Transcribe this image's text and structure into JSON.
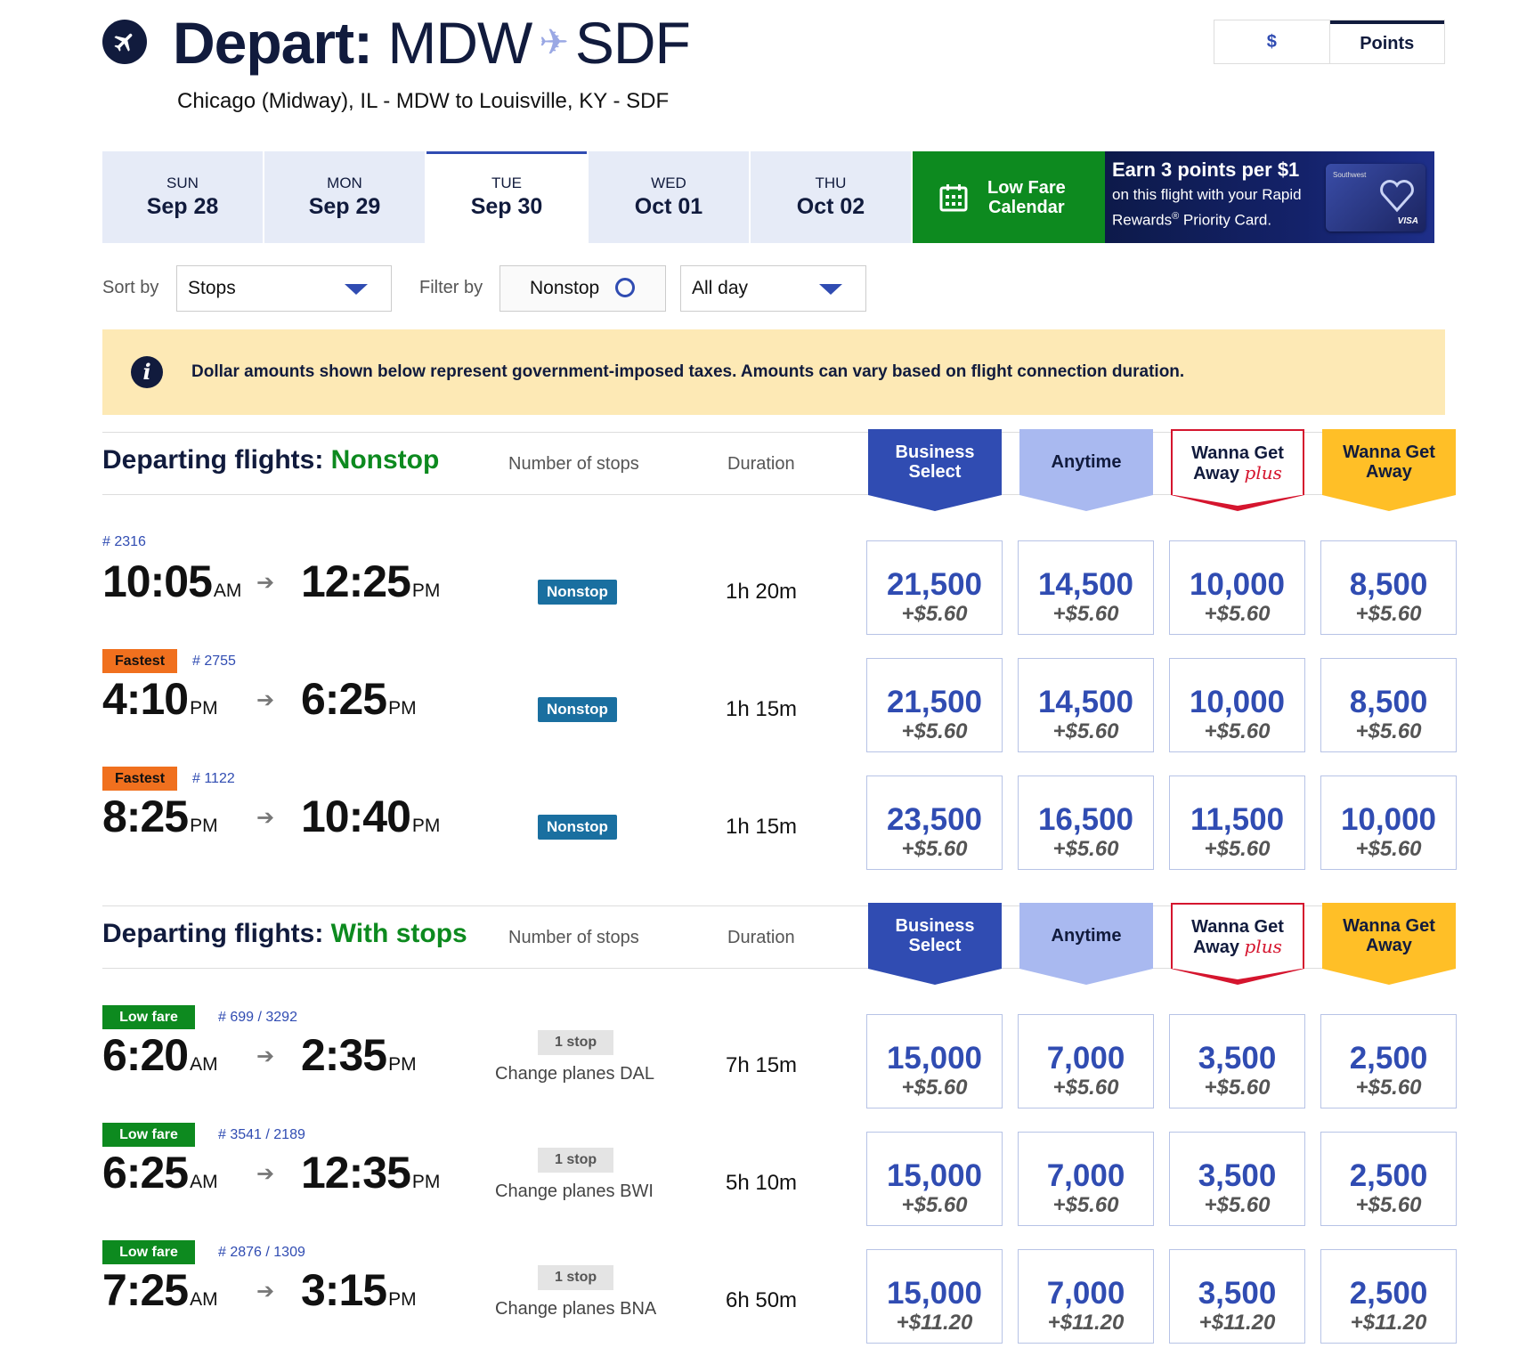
{
  "header": {
    "title_prefix": "Depart:",
    "origin": "MDW",
    "arrow_glyph": "✈",
    "destination": "SDF",
    "subtitle": "Chicago (Midway), IL - MDW to Louisville, KY - SDF"
  },
  "currency_toggle": {
    "dollar_label": "$",
    "points_label": "Points",
    "selected": "Points"
  },
  "dates": [
    {
      "weekday": "SUN",
      "date": "Sep 28"
    },
    {
      "weekday": "MON",
      "date": "Sep 29"
    },
    {
      "weekday": "TUE",
      "date": "Sep 30",
      "selected": true
    },
    {
      "weekday": "WED",
      "date": "Oct 01"
    },
    {
      "weekday": "THU",
      "date": "Oct 02"
    }
  ],
  "low_fare_calendar": {
    "line1": "Low Fare",
    "line2": "Calendar",
    "icon": "calendar-icon"
  },
  "promo": {
    "headline": "Earn 3 points per $1",
    "line1": "on this flight with your Rapid",
    "line2_pre": "Rewards",
    "line2_sup": "®",
    "line2_post": " Priority Card.",
    "card_brand": "VISA",
    "card_logo": "Southwest"
  },
  "controls": {
    "sort_label": "Sort by",
    "sort_value": "Stops",
    "filter_label": "Filter by",
    "nonstop_filter": "Nonstop",
    "time_value": "All day"
  },
  "notice": {
    "icon": "i",
    "text": "Dollar amounts shown below represent government-imposed taxes. Amounts can vary based on flight connection duration."
  },
  "fare_headers": {
    "business_select": [
      "Business",
      "Select"
    ],
    "anytime": "Anytime",
    "wanna_get_away_plus": [
      "Wanna Get",
      "Away",
      "plus"
    ],
    "wanna_get_away": [
      "Wanna Get",
      "Away"
    ]
  },
  "sections": [
    {
      "title_prefix": "Departing flights:",
      "title_highlight": "Nonstop",
      "col_stops": "Number of stops",
      "col_duration": "Duration",
      "flights": [
        {
          "badge": "",
          "flight_no": "# 2316",
          "dep": "10:05",
          "dep_ap": "AM",
          "arr": "12:25",
          "arr_ap": "PM",
          "stops": "Nonstop",
          "change": "",
          "duration": "1h 20m",
          "prices": [
            [
              "21,500",
              "+$5.60"
            ],
            [
              "14,500",
              "+$5.60"
            ],
            [
              "10,000",
              "+$5.60"
            ],
            [
              "8,500",
              "+$5.60"
            ]
          ]
        },
        {
          "badge": "Fastest",
          "flight_no": "# 2755",
          "dep": "4:10",
          "dep_ap": "PM",
          "arr": "6:25",
          "arr_ap": "PM",
          "stops": "Nonstop",
          "change": "",
          "duration": "1h 15m",
          "prices": [
            [
              "21,500",
              "+$5.60"
            ],
            [
              "14,500",
              "+$5.60"
            ],
            [
              "10,000",
              "+$5.60"
            ],
            [
              "8,500",
              "+$5.60"
            ]
          ]
        },
        {
          "badge": "Fastest",
          "flight_no": "# 1122",
          "dep": "8:25",
          "dep_ap": "PM",
          "arr": "10:40",
          "arr_ap": "PM",
          "stops": "Nonstop",
          "change": "",
          "duration": "1h 15m",
          "prices": [
            [
              "23,500",
              "+$5.60"
            ],
            [
              "16,500",
              "+$5.60"
            ],
            [
              "11,500",
              "+$5.60"
            ],
            [
              "10,000",
              "+$5.60"
            ]
          ]
        }
      ]
    },
    {
      "title_prefix": "Departing flights:",
      "title_highlight": "With stops",
      "col_stops": "Number of stops",
      "col_duration": "Duration",
      "flights": [
        {
          "badge": "Low fare",
          "flight_no": "# 699 / 3292",
          "dep": "6:20",
          "dep_ap": "AM",
          "arr": "2:35",
          "arr_ap": "PM",
          "stops": "1 stop",
          "change": "Change planes DAL",
          "duration": "7h 15m",
          "prices": [
            [
              "15,000",
              "+$5.60"
            ],
            [
              "7,000",
              "+$5.60"
            ],
            [
              "3,500",
              "+$5.60"
            ],
            [
              "2,500",
              "+$5.60"
            ]
          ]
        },
        {
          "badge": "Low fare",
          "flight_no": "# 3541 / 2189",
          "dep": "6:25",
          "dep_ap": "AM",
          "arr": "12:35",
          "arr_ap": "PM",
          "stops": "1 stop",
          "change": "Change planes BWI",
          "duration": "5h 10m",
          "prices": [
            [
              "15,000",
              "+$5.60"
            ],
            [
              "7,000",
              "+$5.60"
            ],
            [
              "3,500",
              "+$5.60"
            ],
            [
              "2,500",
              "+$5.60"
            ]
          ]
        },
        {
          "badge": "Low fare",
          "flight_no": "# 2876 / 1309",
          "dep": "7:25",
          "dep_ap": "AM",
          "arr": "3:15",
          "arr_ap": "PM",
          "stops": "1 stop",
          "change": "Change planes BNA",
          "duration": "6h 50m",
          "prices": [
            [
              "15,000",
              "+$11.20"
            ],
            [
              "7,000",
              "+$11.20"
            ],
            [
              "3,500",
              "+$11.20"
            ],
            [
              "2,500",
              "+$11.20"
            ]
          ]
        }
      ]
    }
  ],
  "colors": {
    "navy": "#111b3d",
    "blue": "#304cb2",
    "green": "#0d8a1f",
    "orange": "#f0701e",
    "yellow": "#ffbf27",
    "red": "#d5152e",
    "notice_bg": "#fde9b5"
  }
}
